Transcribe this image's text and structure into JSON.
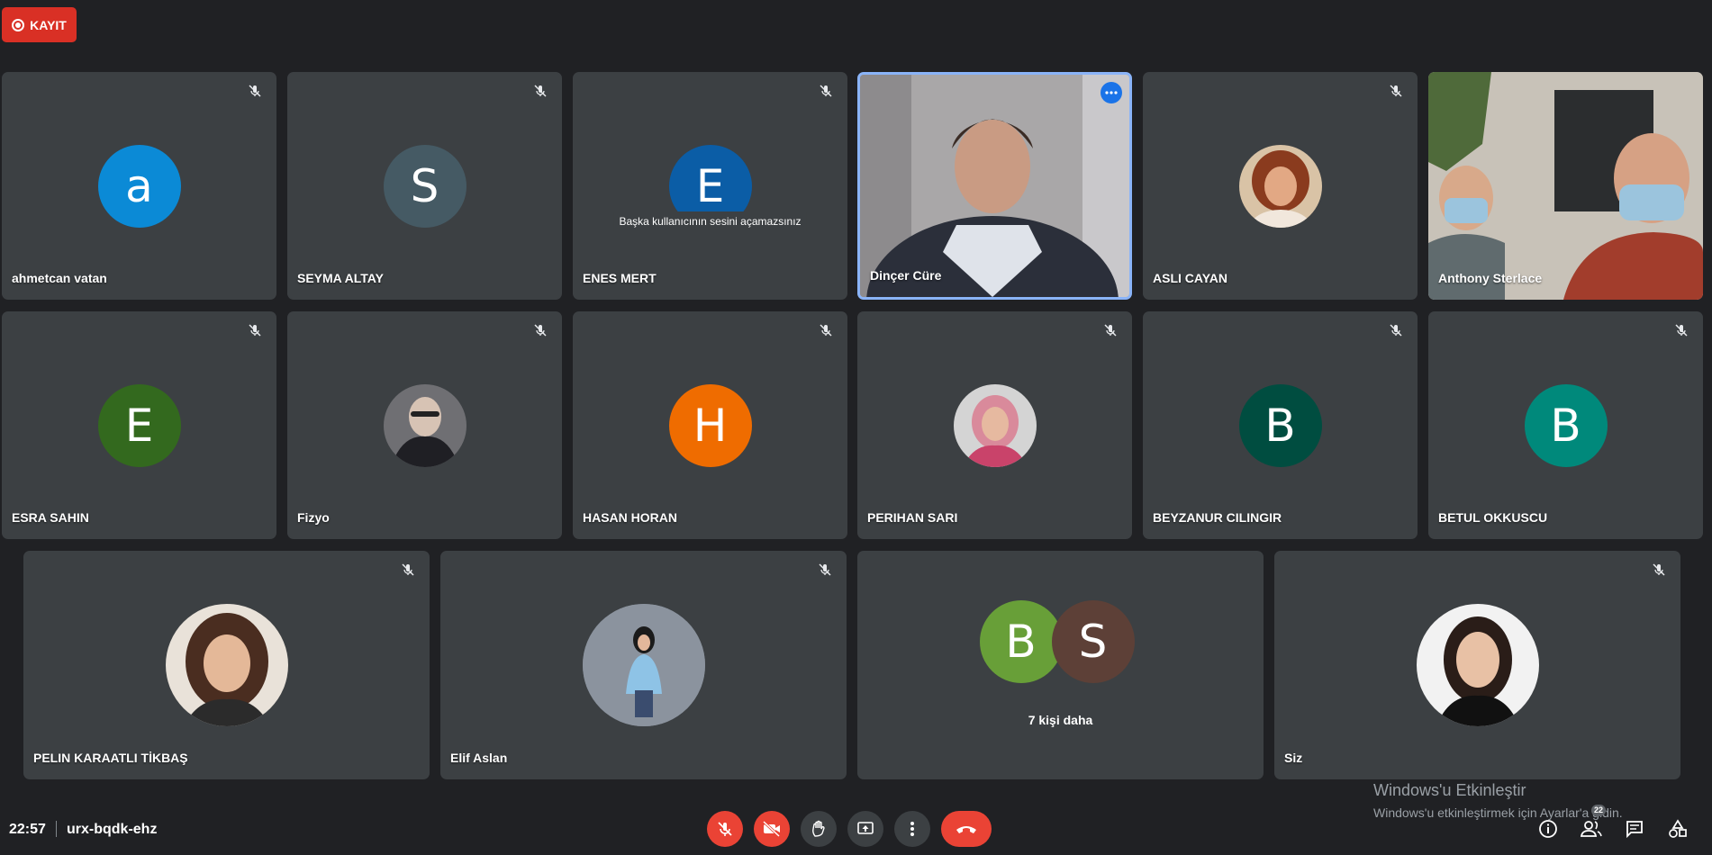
{
  "recording": {
    "label": "KAYIT"
  },
  "colors": {
    "accent": "#8ab4f8",
    "danger": "#ea4335",
    "tile": "#3c4043",
    "bg": "#202124"
  },
  "participants": {
    "ahmetcan": {
      "name": "ahmetcan vatan",
      "initial": "a",
      "color": "#0b8ad6"
    },
    "seyma": {
      "name": "SEYMA ALTAY",
      "initial": "S",
      "color": "#455a64"
    },
    "enes": {
      "name": "ENES MERT",
      "initial": "E",
      "color": "#0b5da6",
      "tooltip": "Başka kullanıcının sesini açamazsınız"
    },
    "dincer": {
      "name": "Dinçer Cüre"
    },
    "asli": {
      "name": "ASLI CAYAN"
    },
    "anthony": {
      "name": "Anthony Sterlace"
    },
    "esra": {
      "name": "ESRA SAHIN",
      "initial": "E",
      "color": "#33691e"
    },
    "fizyo": {
      "name": "Fizyo"
    },
    "hasan": {
      "name": "HASAN HORAN",
      "initial": "H",
      "color": "#ef6c00"
    },
    "perihan": {
      "name": "PERIHAN SARI"
    },
    "beyzanur": {
      "name": "BEYZANUR CILINGIR",
      "initial": "B",
      "color": "#004d40"
    },
    "betul": {
      "name": "BETUL OKKUSCU",
      "initial": "B",
      "color": "#00897b"
    },
    "pelin": {
      "name": "PELIN KARAATLI TİKBAŞ"
    },
    "elif": {
      "name": "Elif Aslan"
    },
    "others": {
      "initial1": "B",
      "color1": "#689f38",
      "initial2": "S",
      "color2": "#5d4037",
      "label": "7 kişi daha"
    },
    "self": {
      "name": "Siz"
    }
  },
  "bottom": {
    "time": "22:57",
    "meeting_code": "urx-bqdk-ehz",
    "participant_count": "22"
  },
  "windows_activation": {
    "title": "Windows'u Etkinleştir",
    "subtitle": "Windows'u etkinleştirmek için Ayarlar'a gidin."
  }
}
